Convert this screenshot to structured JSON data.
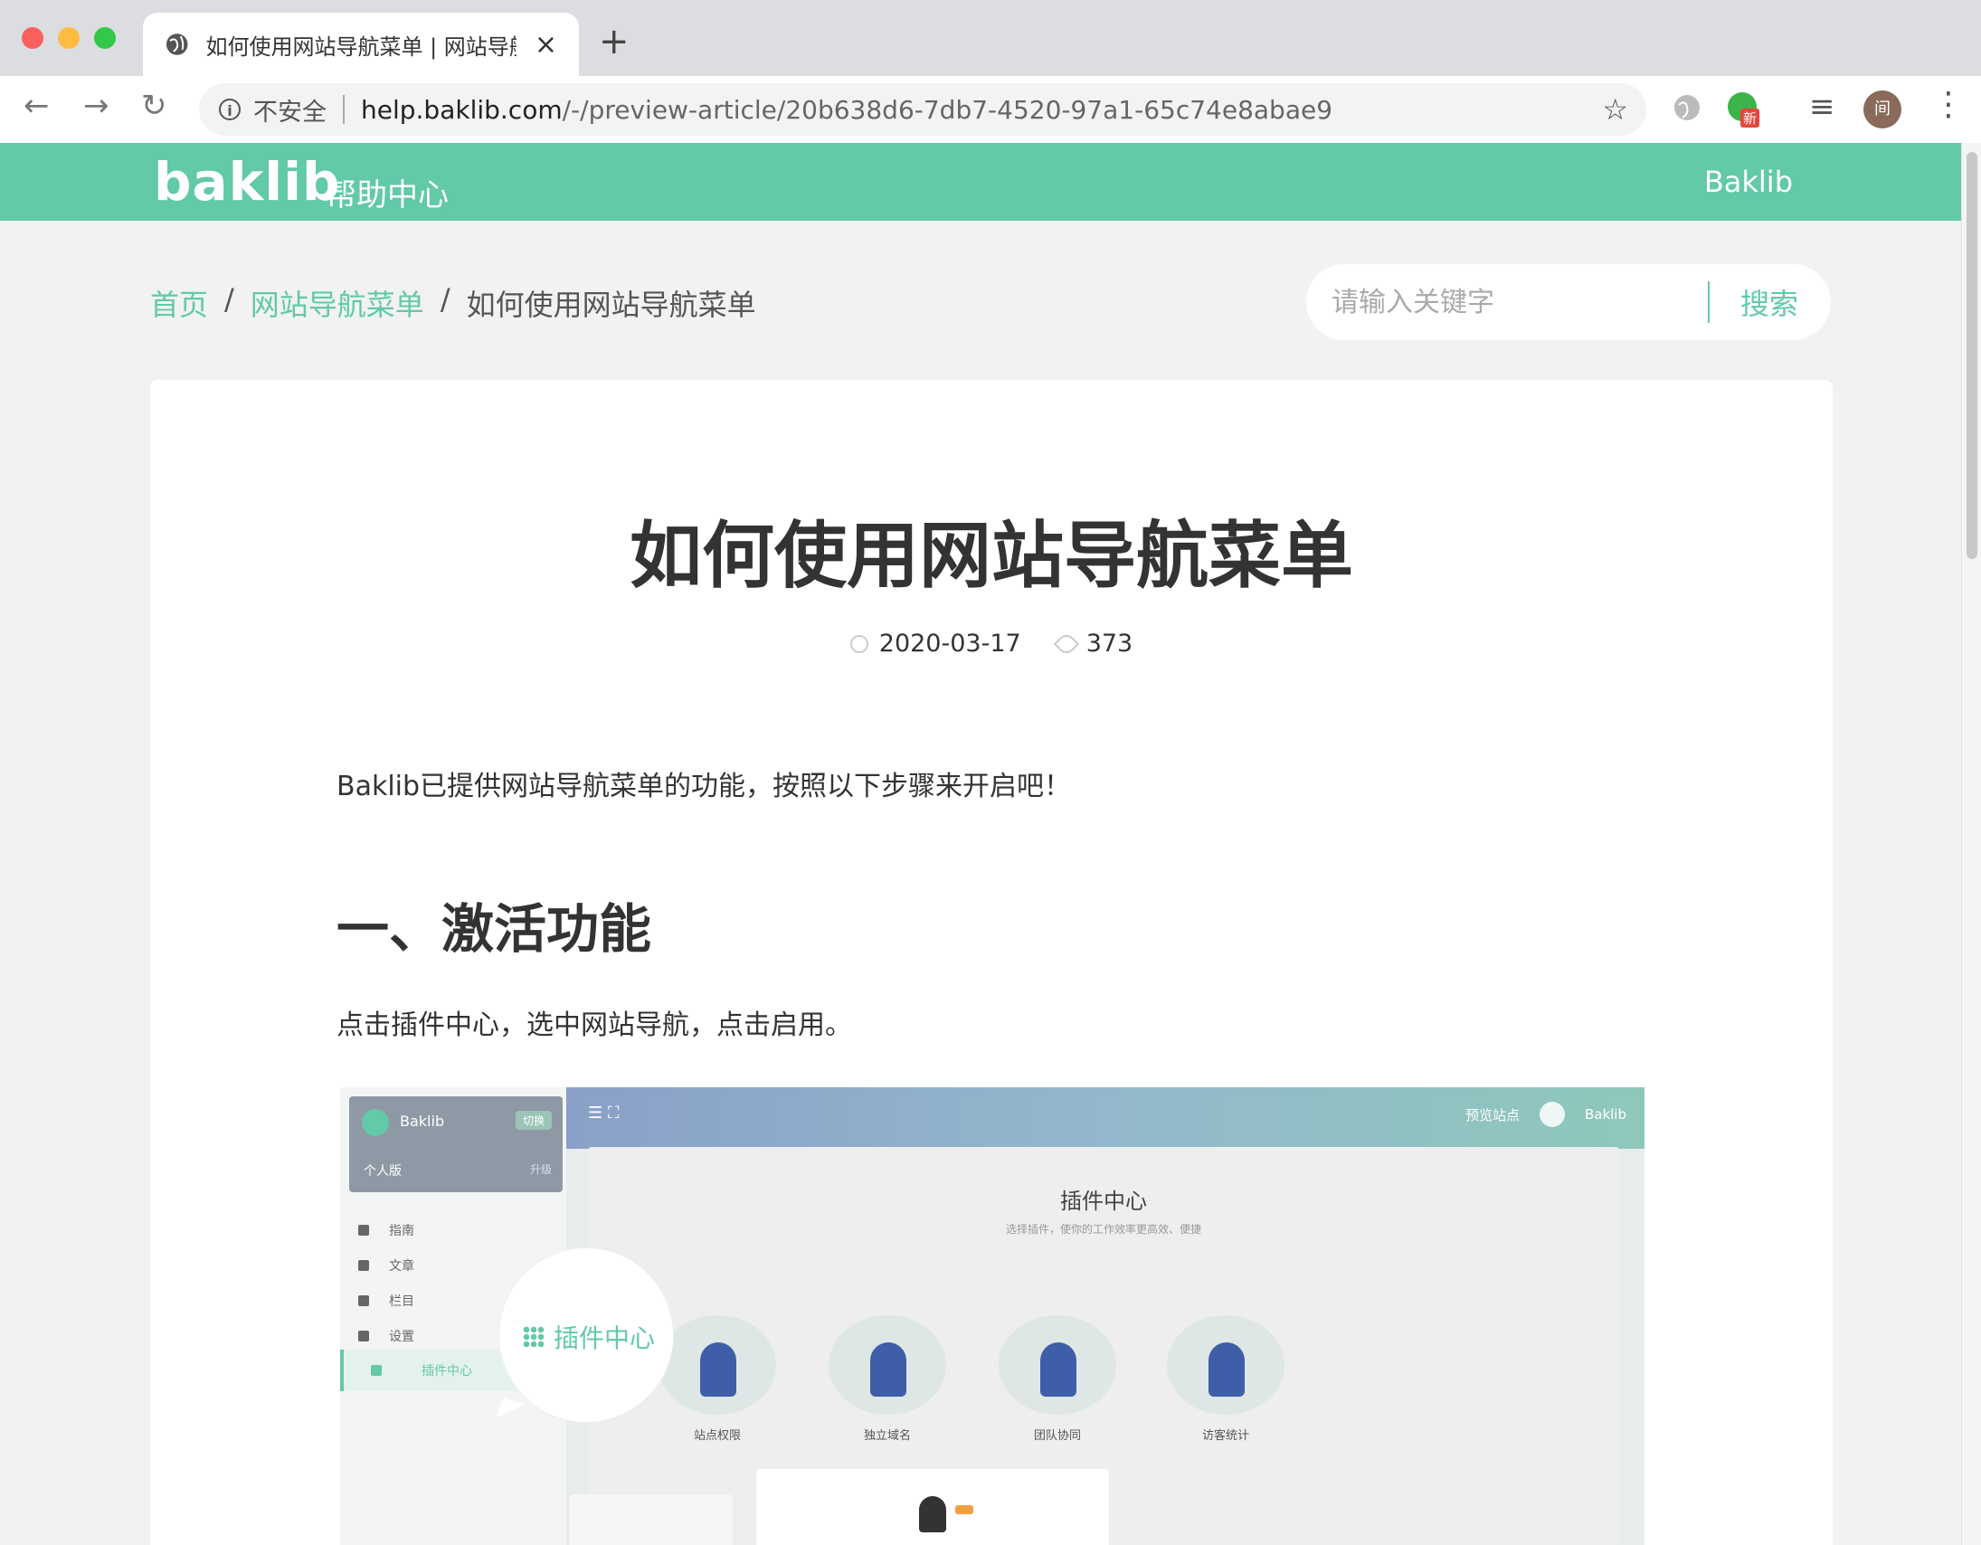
{
  "browser": {
    "tab_title": "如何使用网站导航菜单 | 网站导航",
    "tab_close": "×",
    "new_tab": "+",
    "back": "←",
    "forward": "→",
    "reload": "↻",
    "security_label": "不安全",
    "url_host": "help.baklib.com",
    "url_path": "/-/preview-article/20b638d6-7db7-4520-97a1-65c74e8abae9",
    "star": "☆",
    "extension_badge": "新",
    "avatar_text": "间",
    "kebab": "⋮",
    "info": "i",
    "ext_list": "≡"
  },
  "site": {
    "logo": "baklib",
    "logo_sub": "帮助中心",
    "header_link": "Baklib"
  },
  "breadcrumb": {
    "items": [
      "首页",
      "网站导航菜单",
      "如何使用网站导航菜单"
    ],
    "sep": "/"
  },
  "search": {
    "placeholder": "请输入关键字",
    "button": "搜索"
  },
  "article": {
    "title": "如何使用网站导航菜单",
    "date": "2020-03-17",
    "views": "373",
    "intro": "Baklib已提供网站导航菜单的功能，按照以下步骤来开启吧！",
    "h2": "一、激活功能",
    "step_text": "点击插件中心，选中网站导航，点击启用。"
  },
  "screenshot": {
    "brand": "Baklib",
    "switch": "切换",
    "edition": "个人版",
    "upgrade": "升级",
    "menu": [
      "指南",
      "文章",
      "栏目",
      "设置",
      "插件中心"
    ],
    "top_icons": "☰  ⛶",
    "preview": "预览站点",
    "bot_name": "Baklib",
    "panel_title": "插件中心",
    "panel_subtitle": "选择插件，使你的工作效率更高效、便捷",
    "plugins": [
      "站点权限",
      "独立域名",
      "团队协同",
      "访客统计"
    ],
    "callout": "插件中心"
  },
  "colors": {
    "accent": "#62c9a9",
    "text": "#333333"
  }
}
